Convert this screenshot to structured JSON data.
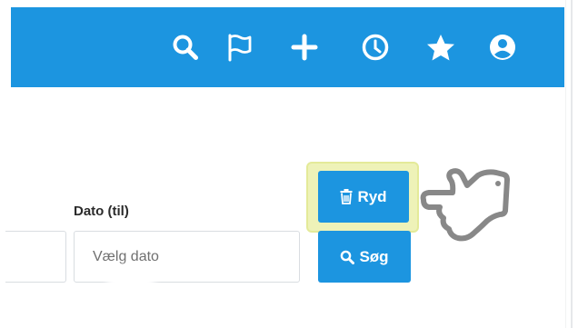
{
  "header": {
    "icons": [
      "search-icon",
      "flag-icon",
      "plus-icon",
      "clock-icon",
      "star-icon",
      "user-icon"
    ]
  },
  "filters": {
    "date_to_label": "Dato (til)",
    "date_to_placeholder": "Vælg dato"
  },
  "actions": {
    "clear_label": "Ryd",
    "search_label": "Søg"
  },
  "colors": {
    "primary": "#1c95e0",
    "highlight": "#eef2b8",
    "hand": "#8a8a8a"
  }
}
